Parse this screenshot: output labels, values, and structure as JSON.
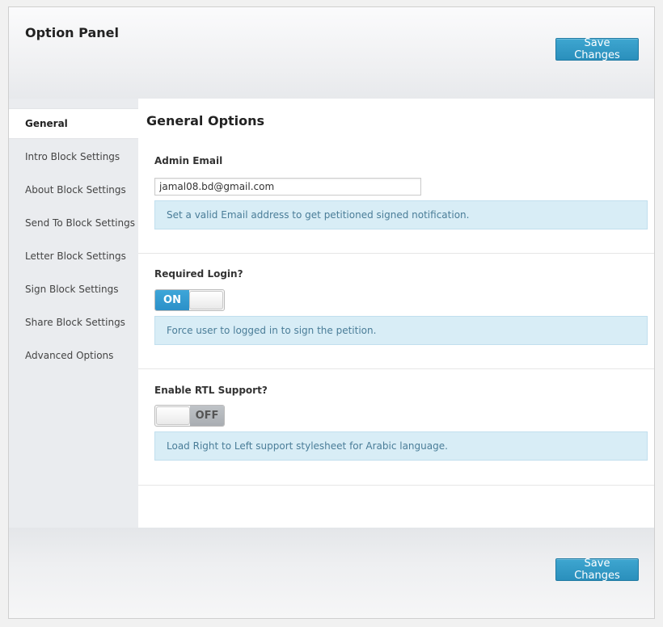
{
  "header": {
    "title": "Option Panel",
    "save_label": "Save Changes"
  },
  "footer": {
    "save_label": "Save Changes"
  },
  "sidebar": {
    "items": [
      {
        "label": "General",
        "active": true
      },
      {
        "label": "Intro Block Settings"
      },
      {
        "label": "About Block Settings"
      },
      {
        "label": "Send To Block Settings"
      },
      {
        "label": "Letter Block Settings"
      },
      {
        "label": "Sign Block Settings"
      },
      {
        "label": "Share Block Settings"
      },
      {
        "label": "Advanced Options"
      }
    ]
  },
  "main": {
    "title": "General Options",
    "fields": {
      "admin_email": {
        "label": "Admin Email",
        "value": "jamal08.bd@gmail.com",
        "description": "Set a valid Email address to get petitioned signed notification."
      },
      "required_login": {
        "label": "Required Login?",
        "state_label": "ON",
        "enabled": true,
        "description": "Force user to logged in to sign the petition."
      },
      "rtl_support": {
        "label": "Enable RTL Support?",
        "state_label": "OFF",
        "enabled": false,
        "description": "Load Right to Left support stylesheet for Arabic language."
      }
    }
  },
  "colors": {
    "accent": "#2a8fbc",
    "toggle_on": "#2b90c8",
    "info_bg": "#d8edf6",
    "info_text": "#4a7d98"
  }
}
